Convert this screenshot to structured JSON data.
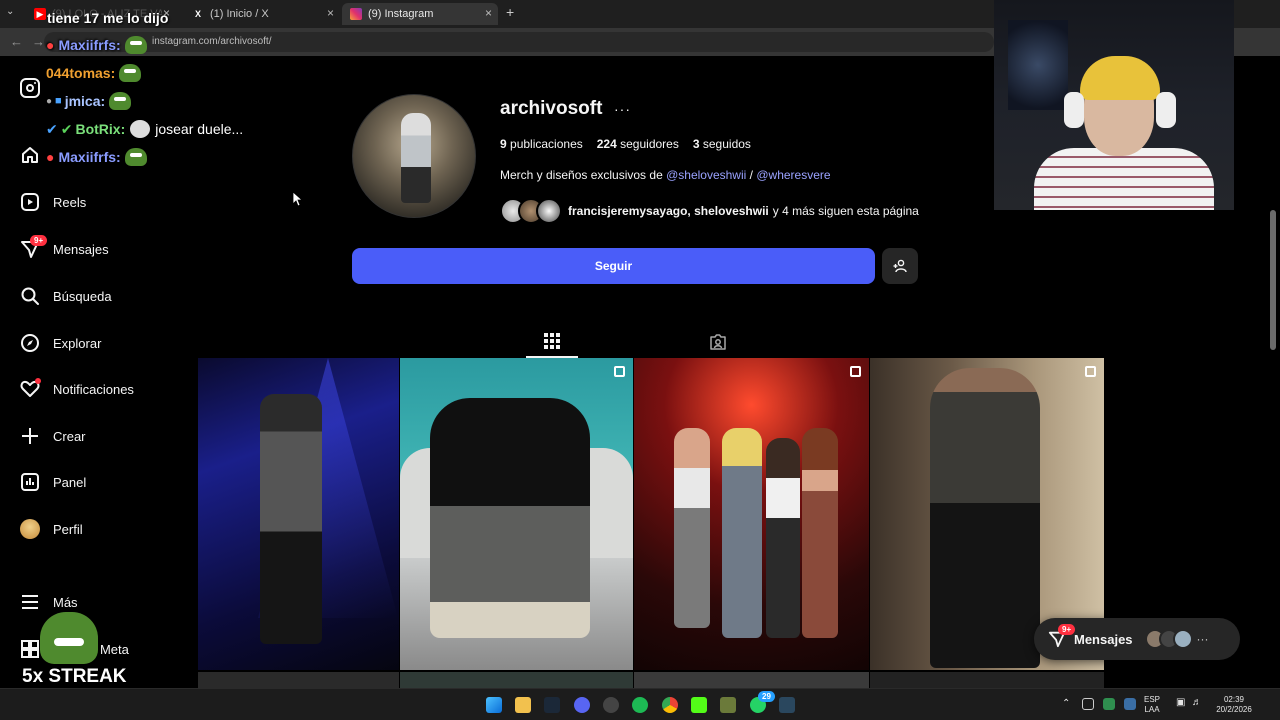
{
  "browser": {
    "tabs": [
      {
        "label": "(9) LOLO - ALIZ TE VAS BORRO",
        "icon": "youtube-icon"
      },
      {
        "label": "(1) Inicio / X",
        "icon": "x-icon"
      },
      {
        "label": "(9) Instagram",
        "icon": "instagram-icon"
      }
    ],
    "url": "instagram.com/archivosoft/"
  },
  "chat_overlay": {
    "header": "tiene 17 me lo dijo",
    "lines": [
      {
        "user": "Maxiifrfs:",
        "color": "#8a9cff"
      },
      {
        "user": "044tomas:",
        "color": "#f0a030"
      },
      {
        "user": "jmica:",
        "color": "#a9c4ff"
      },
      {
        "user": "BotRix:",
        "color": "#7be07b",
        "message": "josear duele..."
      },
      {
        "user": "Maxiifrfs:",
        "color": "#8a9cff"
      }
    ]
  },
  "sidebar": {
    "items": [
      {
        "label": "Reels",
        "icon": "reels-icon"
      },
      {
        "label": "Mensajes",
        "icon": "messages-icon",
        "badge": "9+"
      },
      {
        "label": "Búsqueda",
        "icon": "search-icon"
      },
      {
        "label": "Explorar",
        "icon": "compass-icon"
      },
      {
        "label": "Notificaciones",
        "icon": "heart-icon"
      },
      {
        "label": "Crear",
        "icon": "plus-icon"
      },
      {
        "label": "Panel",
        "icon": "chart-icon"
      },
      {
        "label": "Perfil",
        "icon": "avatar-icon"
      },
      {
        "label": "Más",
        "icon": "menu-icon"
      },
      {
        "label": "...en de Meta",
        "icon": "grid-icon"
      }
    ]
  },
  "profile": {
    "username": "archivosoft",
    "posts_count": "9",
    "posts_label": "publicaciones",
    "followers_count": "224",
    "followers_label": "seguidores",
    "following_count": "3",
    "following_label": "seguidos",
    "bio_prefix": "Merch y diseños exclusivos de",
    "bio_link1": "@sheloveshwii",
    "bio_sep": "/",
    "bio_link2": "@wheresvere",
    "followed_by_names": "francisjeremysayago, sheloveshwii",
    "followed_by_suffix": "y 4 más siguen esta página",
    "follow_button": "Seguir"
  },
  "messages_pill": {
    "label": "Mensajes",
    "badge": "9+"
  },
  "overlay": {
    "streak": "5x STREAK"
  },
  "taskbar": {
    "lang_top": "ESP",
    "lang_bottom": "LAA",
    "time": "02:39",
    "date": "20/2/2026",
    "whatsapp_badge": "29"
  },
  "colors": {
    "accent": "#4a5df9",
    "link": "#9aa2ff",
    "notification": "#ff3040",
    "background": "#000000"
  }
}
